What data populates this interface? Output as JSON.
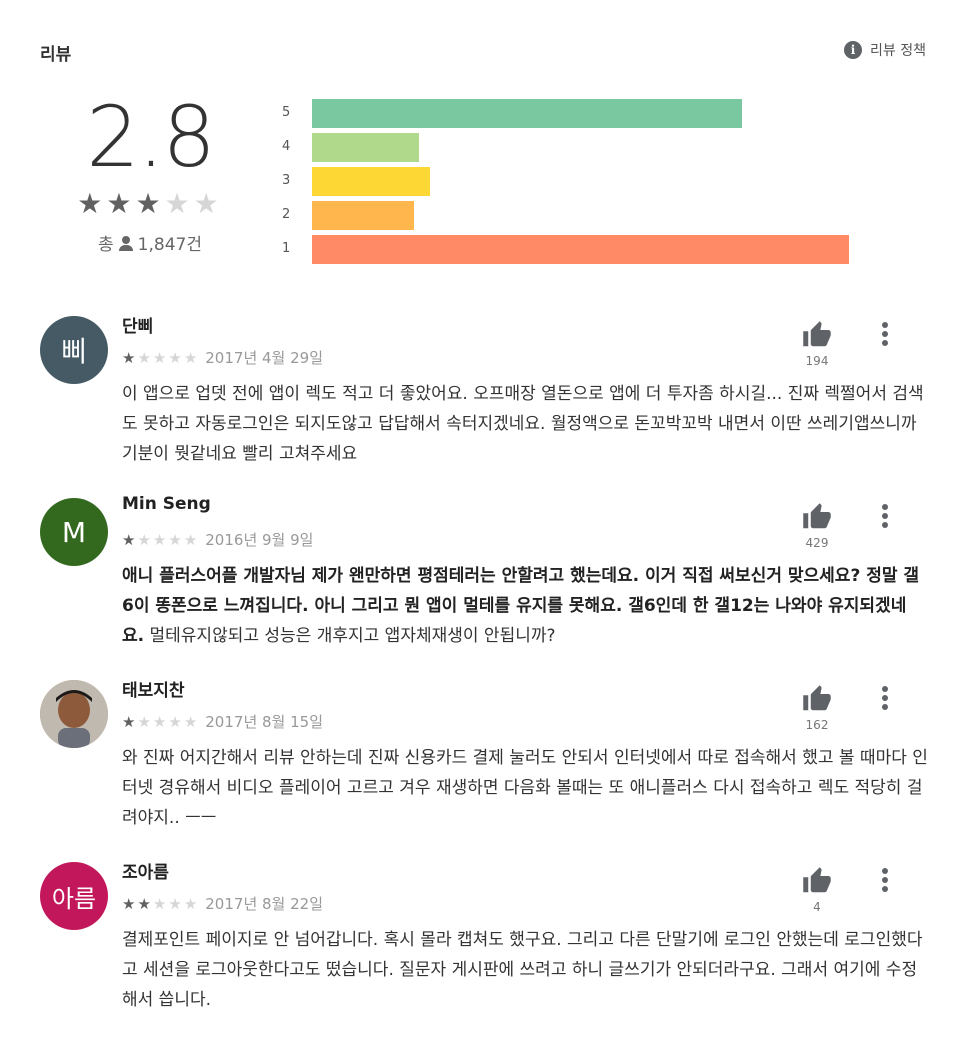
{
  "section_title": "리뷰",
  "policy_label": "리뷰 정책",
  "summary": {
    "average": "2.8",
    "total_prefix": "총",
    "total_count": "1,847건"
  },
  "histogram": [
    {
      "label": "5",
      "fraction": 0.8,
      "color": "#7ac8a0"
    },
    {
      "label": "4",
      "fraction": 0.2,
      "color": "#b0d98b"
    },
    {
      "label": "3",
      "fraction": 0.22,
      "color": "#fdd835"
    },
    {
      "label": "2",
      "fraction": 0.19,
      "color": "#ffb74d"
    },
    {
      "label": "1",
      "fraction": 1.0,
      "color": "#ff8a65"
    }
  ],
  "reviews": [
    {
      "avatar_text": "삐",
      "avatar_color": "#455a64",
      "author": "단삐",
      "rating": 1,
      "date": "2017년 4월 29일",
      "likes": "194",
      "bold_text": "",
      "text": "이 앱으로 업뎃 전에 앱이 렉도 적고 더 좋았어요. 오프매장 열돈으로 앱에 더 투자좀 하시길... 진짜 렉쩔어서 검색도 못하고 자동로그인은 되지도않고 답답해서 속터지겠네요. 월정액으로 돈꼬박꼬박 내면서 이딴 쓰레기앱쓰니까 기분이 뭣같네요 빨리 고쳐주세요"
    },
    {
      "avatar_text": "M",
      "avatar_color": "#33691e",
      "author": "Min Seng",
      "rating": 1,
      "date": "2016년 9월 9일",
      "likes": "429",
      "bold_text": "애니 플러스어플 개발자님 제가 왠만하면 평점테러는 안할려고 했는데요. 이거 직접 써보신거 맞으세요? 정말 갤 6이 똥폰으로 느껴집니다. 아니 그리고 뭔 앱이 멀테를 유지를 못해요. 갤6인데 한 갤12는 나와야 유지되겠네요.",
      "text": " 멀테유지않되고 성능은 개후지고 앱자체재생이 안됩니까?"
    },
    {
      "avatar_text": "",
      "avatar_color": "#c8a88c",
      "author": "태보지찬",
      "rating": 1,
      "date": "2017년 8월 15일",
      "likes": "162",
      "bold_text": "",
      "text": "와 진짜 어지간해서 리뷰 안하는데 진짜 신용카드 결제 눌러도 안되서 인터넷에서 따로 접속해서 했고 볼 때마다 인터넷 경유해서 비디오 플레이어 고르고 겨우 재생하면 다음화 볼때는 또 애니플러스 다시 접속하고 렉도 적당히 걸려야지.. ㅡㅡ"
    },
    {
      "avatar_text": "아름",
      "avatar_color": "#c2185b",
      "author": "조아름",
      "rating": 2,
      "date": "2017년 8월 22일",
      "likes": "4",
      "bold_text": "",
      "text": "결제포인트 페이지로 안 넘어갑니다. 혹시 몰라 캡쳐도 했구요. 그리고 다른 단말기에 로그인 안했는데 로그인했다고 세션을 로그아웃한다고도 떴습니다. 질문자 게시판에 쓰려고 하니 글쓰기가 안되더라구요. 그래서 여기에 수정해서 씁니다."
    }
  ]
}
